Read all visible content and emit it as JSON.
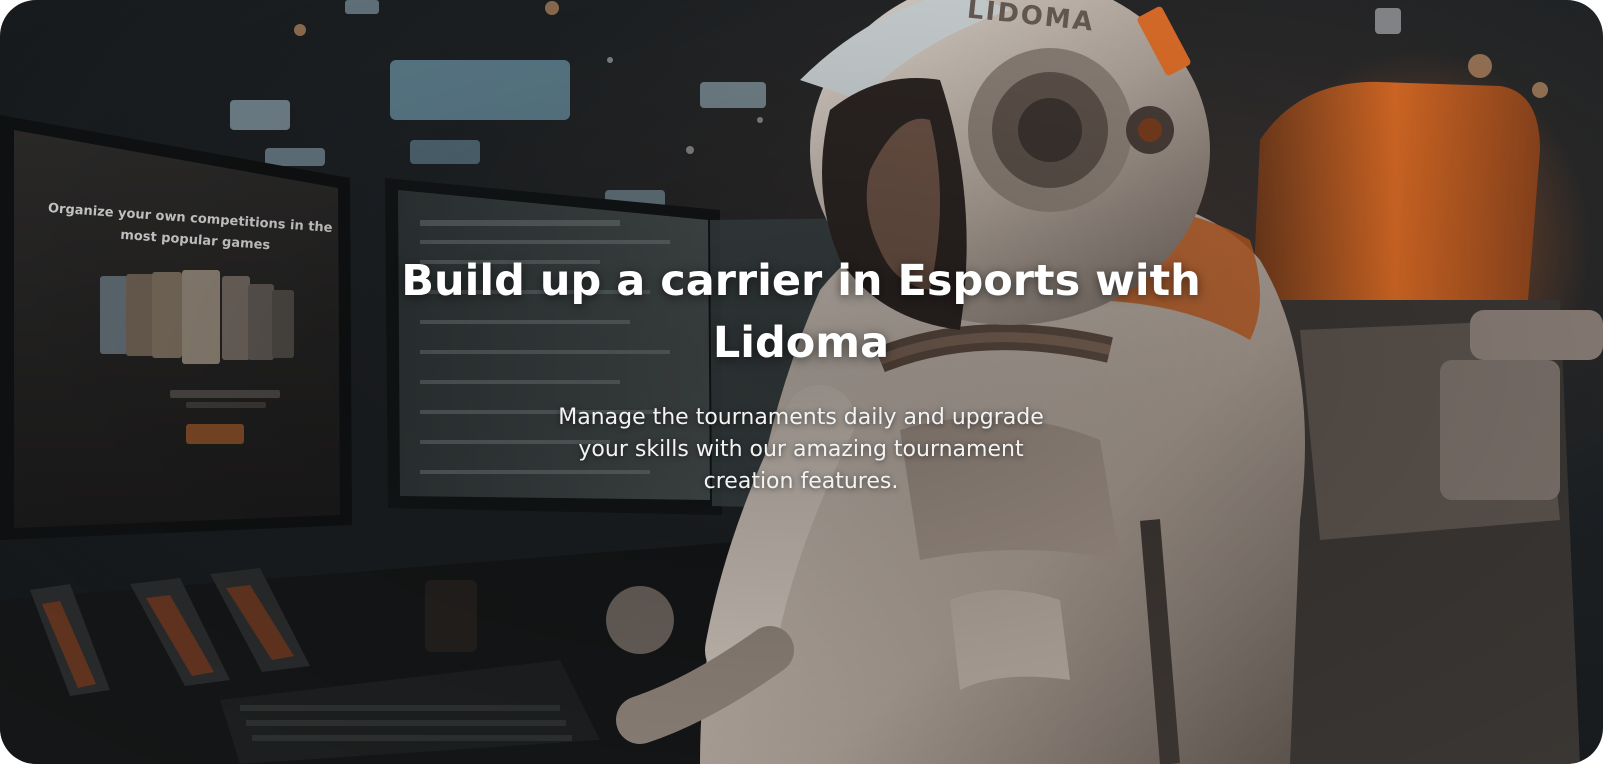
{
  "hero": {
    "headline": "Build up a carrier in Esports with Lidoma",
    "subtext": "Manage the tournaments daily and upgrade your skills with our amazing tournament creation features.",
    "monitor_heading_line1": "Organize your own competitions in the",
    "monitor_heading_line2": "most popular games",
    "helmet_logo": "LIDOMA"
  },
  "colors": {
    "accent": "#e2702a",
    "text": "#ffffff",
    "background": "#1b1f22"
  },
  "icons": {
    "scene": "astronaut-gamer-illustration"
  }
}
